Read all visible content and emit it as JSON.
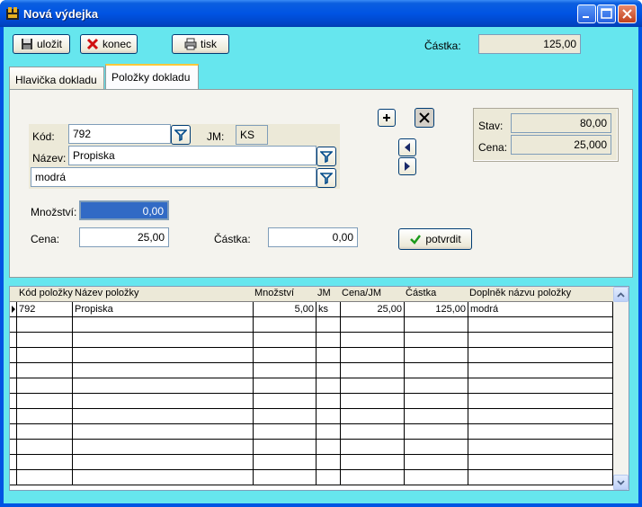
{
  "window": {
    "title": "Nová výdejka"
  },
  "toolbar": {
    "save_label": "uložit",
    "close_label": "konec",
    "print_label": "tisk",
    "amount_label": "Částka:",
    "amount_value": "125,00"
  },
  "tabs": [
    {
      "label": "Hlavička dokladu",
      "active": false
    },
    {
      "label": "Položky dokladu",
      "active": true
    }
  ],
  "form": {
    "code_label": "Kód:",
    "code_value": "792",
    "unit_label": "JM:",
    "unit_value": "KS",
    "name_label": "Název:",
    "name_value": "Propiska",
    "name_suffix_value": "modrá",
    "quantity_label": "Množství:",
    "quantity_value": "0,00",
    "price_label": "Cena:",
    "price_value": "25,00",
    "amount_label": "Částka:",
    "amount_value": "0,00",
    "confirm_label": "potvrdit"
  },
  "stock": {
    "stav_label": "Stav:",
    "stav_value": "80,00",
    "cena_label": "Cena:",
    "cena_value": "25,000"
  },
  "grid": {
    "columns": [
      "Kód položky",
      "Název položky",
      "Množství",
      "JM",
      "Cena/JM",
      "Částka",
      "Doplněk názvu položky"
    ],
    "rows": [
      [
        "792",
        "Propiska",
        "5,00",
        "ks",
        "25,00",
        "125,00",
        "modrá"
      ]
    ]
  },
  "colors": {
    "background": "#66e6ee",
    "titlebar": "#0054e3",
    "selection": "#316ac5"
  }
}
